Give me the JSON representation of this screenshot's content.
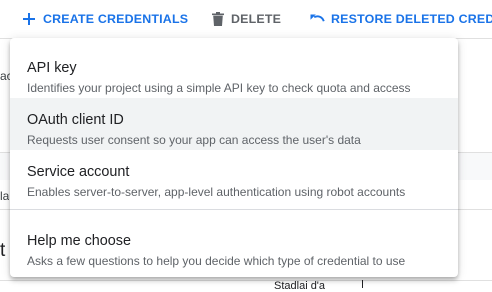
{
  "toolbar": {
    "create_label": "CREATE CREDENTIALS",
    "delete_label": "DELETE",
    "restore_label": "RESTORE DELETED CREDEN"
  },
  "menu": {
    "items": [
      {
        "title": "API key",
        "description": "Identifies your project using a simple API key to check quota and access"
      },
      {
        "title": "OAuth client ID",
        "description": "Requests user consent so your app can access the user's data"
      },
      {
        "title": "Service account",
        "description": "Enables server-to-server, app-level authentication using robot accounts"
      },
      {
        "title": "Help me choose",
        "description": "Asks a few questions to help you decide which type of credential to use"
      }
    ]
  },
  "background": {
    "fragment_1": "ac",
    "fragment_2": "la",
    "fragment_3": "t I",
    "bottom_text": "Stadlai d'a"
  },
  "colors": {
    "accent": "#1a73e8",
    "muted": "#5f6368",
    "hover": "#f1f3f4"
  },
  "icons": {
    "create": "plus-icon",
    "delete": "trash-icon",
    "restore": "undo-icon"
  }
}
